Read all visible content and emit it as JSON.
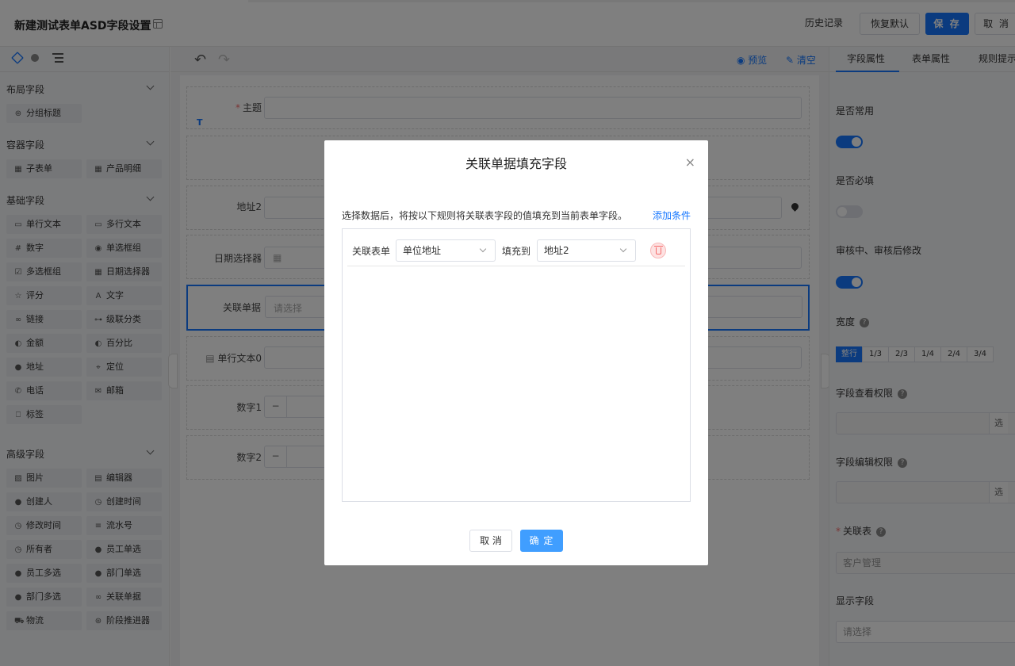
{
  "header": {
    "title": "新建测试表单ASD字段设置",
    "history": "历史记录",
    "restore": "恢复默认",
    "save": "保 存",
    "cancel": "取 消"
  },
  "left": {
    "sections": [
      {
        "title": "布局字段",
        "items": [
          {
            "label": "分组标题",
            "icon": "group-title-icon",
            "glyph": "⊛"
          }
        ]
      },
      {
        "title": "容器字段",
        "items": [
          {
            "label": "子表单",
            "icon": "table-icon",
            "glyph": "▦"
          },
          {
            "label": "产品明细",
            "icon": "table-icon",
            "glyph": "▦"
          }
        ]
      },
      {
        "title": "基础字段",
        "items": [
          {
            "label": "单行文本",
            "icon": "single-line-icon",
            "glyph": "▭"
          },
          {
            "label": "多行文本",
            "icon": "multi-line-icon",
            "glyph": "▭"
          },
          {
            "label": "数字",
            "icon": "number-icon",
            "glyph": "#"
          },
          {
            "label": "单选框组",
            "icon": "radio-icon",
            "glyph": "◉"
          },
          {
            "label": "多选框组",
            "icon": "checkbox-icon",
            "glyph": "☑"
          },
          {
            "label": "日期选择器",
            "icon": "calendar-icon",
            "glyph": "▦"
          },
          {
            "label": "评分",
            "icon": "star-icon",
            "glyph": "☆"
          },
          {
            "label": "文字",
            "icon": "text-icon",
            "glyph": "A"
          },
          {
            "label": "链接",
            "icon": "link-icon",
            "glyph": "∞"
          },
          {
            "label": "级联分类",
            "icon": "cascade-icon",
            "glyph": "⊶"
          },
          {
            "label": "金额",
            "icon": "money-icon",
            "glyph": "◐"
          },
          {
            "label": "百分比",
            "icon": "percent-icon",
            "glyph": "◐"
          },
          {
            "label": "地址",
            "icon": "location-icon",
            "glyph": "●"
          },
          {
            "label": "定位",
            "icon": "position-icon",
            "glyph": "⌖"
          },
          {
            "label": "电话",
            "icon": "phone-icon",
            "glyph": "✆"
          },
          {
            "label": "邮箱",
            "icon": "mail-icon",
            "glyph": "✉"
          },
          {
            "label": "标签",
            "icon": "tag-icon",
            "glyph": "⎕"
          }
        ]
      },
      {
        "title": "高级字段",
        "items": [
          {
            "label": "图片",
            "icon": "image-icon",
            "glyph": "▨"
          },
          {
            "label": "编辑器",
            "icon": "editor-icon",
            "glyph": "▤"
          },
          {
            "label": "创建人",
            "icon": "creator-icon",
            "glyph": "●"
          },
          {
            "label": "创建时间",
            "icon": "clock-icon",
            "glyph": "◷"
          },
          {
            "label": "修改时间",
            "icon": "clock-icon",
            "glyph": "◷"
          },
          {
            "label": "流水号",
            "icon": "serial-icon",
            "glyph": "≡"
          },
          {
            "label": "所有者",
            "icon": "owner-icon",
            "glyph": "◷"
          },
          {
            "label": "员工单选",
            "icon": "user-icon",
            "glyph": "●"
          },
          {
            "label": "员工多选",
            "icon": "users-icon",
            "glyph": "●"
          },
          {
            "label": "部门单选",
            "icon": "dept-icon",
            "glyph": "●"
          },
          {
            "label": "部门多选",
            "icon": "dept-icon",
            "glyph": "●"
          },
          {
            "label": "关联单据",
            "icon": "relation-icon",
            "glyph": "∞"
          },
          {
            "label": "物流",
            "icon": "truck-icon",
            "glyph": "⛟"
          },
          {
            "label": "阶段推进器",
            "icon": "stage-icon",
            "glyph": "⊛"
          }
        ]
      }
    ]
  },
  "canvas": {
    "preview": "预览",
    "clear": "清空",
    "fields": {
      "subject": "主题",
      "address2": "地址2",
      "date_picker": "日期选择器",
      "relation": "关联单据",
      "relation_placeholder": "请选择",
      "single_text": "单行文本0",
      "number1": "数字1",
      "number2": "数字2",
      "text_badge": "T",
      "minus": "−"
    }
  },
  "right": {
    "tabs": [
      "字段属性",
      "表单属性",
      "规则提示"
    ],
    "common": "是否常用",
    "required": "是否必填",
    "editable": "审核中、审核后修改",
    "width": "宽度",
    "width_options": [
      "整行",
      "1/3",
      "2/3",
      "1/4",
      "2/4",
      "3/4"
    ],
    "view_perm": "字段查看权限",
    "edit_perm": "字段编辑权限",
    "select_tag": "选",
    "relation_table": "关联表",
    "relation_table_value": "客户管理",
    "display_field": "显示字段",
    "display_placeholder": "请选择",
    "toggles": {
      "common": true,
      "required": false,
      "editable": true
    }
  },
  "modal": {
    "title": "关联单据填充字段",
    "close": "×",
    "description": "选择数据后，将按以下规则将关联表字段的值填充到当前表单字段。",
    "add_condition": "添加条件",
    "rule": {
      "label_source": "关联表单",
      "source_value": "单位地址",
      "label_target": "填充到",
      "target_value": "地址2"
    },
    "cancel": "取 消",
    "ok": "确 定"
  }
}
